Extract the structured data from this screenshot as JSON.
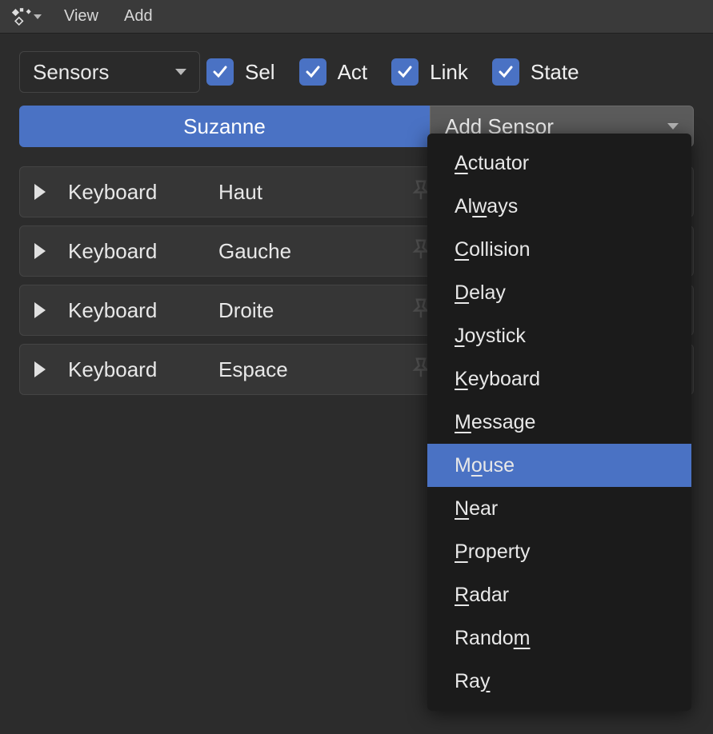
{
  "menubar": {
    "view": "View",
    "add": "Add"
  },
  "toolbar": {
    "category_label": "Sensors",
    "filters": {
      "sel": "Sel",
      "act": "Act",
      "link": "Link",
      "state": "State"
    }
  },
  "header": {
    "object_name": "Suzanne",
    "add_button": "Add Sensor"
  },
  "sensors": [
    {
      "type": "Keyboard",
      "name": "Haut"
    },
    {
      "type": "Keyboard",
      "name": "Gauche"
    },
    {
      "type": "Keyboard",
      "name": "Droite"
    },
    {
      "type": "Keyboard",
      "name": "Espace"
    }
  ],
  "dropdown": {
    "items": [
      {
        "label": "Actuator",
        "pre": "",
        "u": "A",
        "post": "ctuator",
        "hover": false
      },
      {
        "label": "Always",
        "pre": "Al",
        "u": "w",
        "post": "ays",
        "hover": false
      },
      {
        "label": "Collision",
        "pre": "",
        "u": "C",
        "post": "ollision",
        "hover": false
      },
      {
        "label": "Delay",
        "pre": "",
        "u": "D",
        "post": "elay",
        "hover": false
      },
      {
        "label": "Joystick",
        "pre": "",
        "u": "J",
        "post": "oystick",
        "hover": false
      },
      {
        "label": "Keyboard",
        "pre": "",
        "u": "K",
        "post": "eyboard",
        "hover": false
      },
      {
        "label": "Message",
        "pre": "",
        "u": "M",
        "post": "essage",
        "hover": false
      },
      {
        "label": "Mouse",
        "pre": "M",
        "u": "o",
        "post": "use",
        "hover": true
      },
      {
        "label": "Near",
        "pre": "",
        "u": "N",
        "post": "ear",
        "hover": false
      },
      {
        "label": "Property",
        "pre": "",
        "u": "P",
        "post": "roperty",
        "hover": false
      },
      {
        "label": "Radar",
        "pre": "",
        "u": "R",
        "post": "adar",
        "hover": false
      },
      {
        "label": "Random",
        "pre": "Rando",
        "u": "m",
        "post": "",
        "hover": false
      },
      {
        "label": "Ray",
        "pre": "Ra",
        "u": "y",
        "post": "",
        "hover": false
      }
    ]
  }
}
